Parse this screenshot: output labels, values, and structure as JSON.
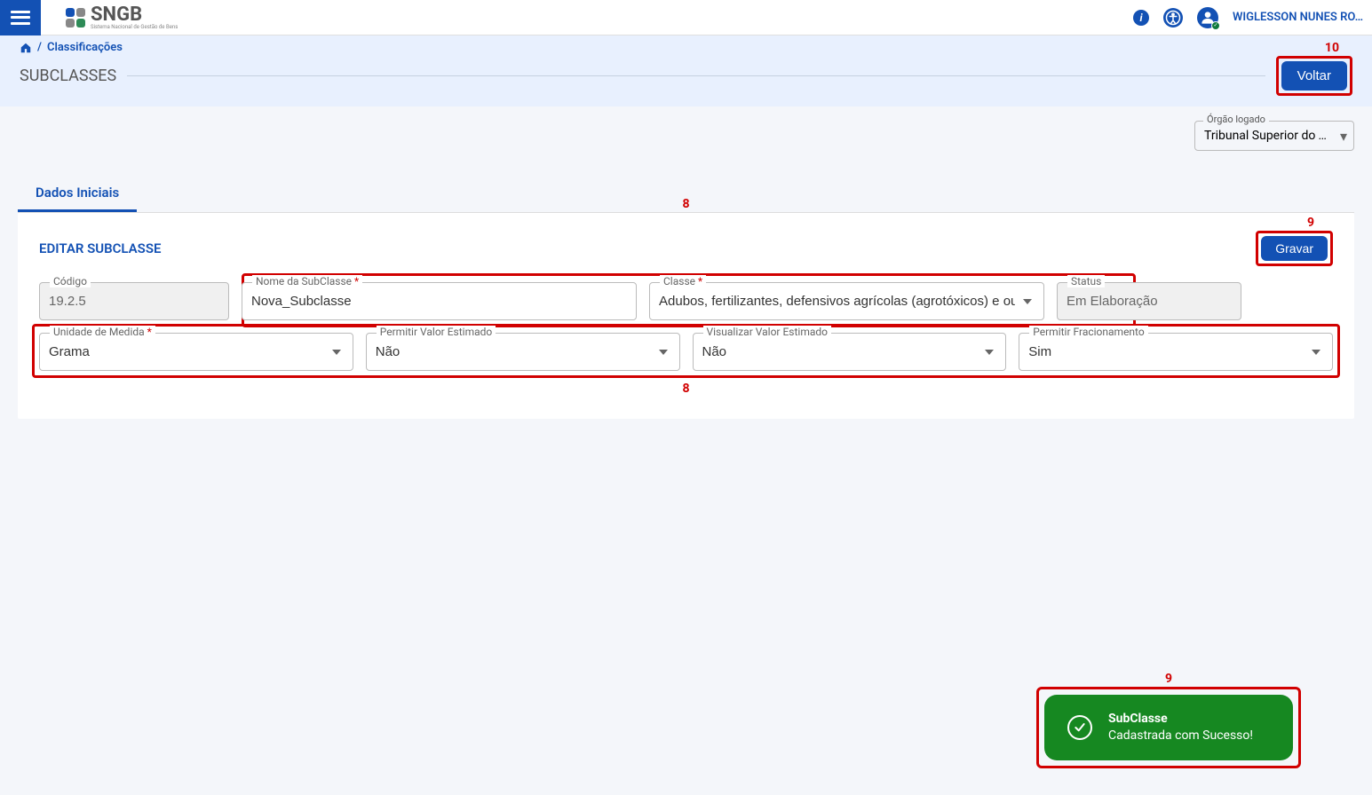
{
  "header": {
    "logo_main": "SNGB",
    "logo_sub": "Sistema Nacional de Gestão de Bens",
    "user_name": "WIGLESSON NUNES RO…"
  },
  "breadcrumb": {
    "separator": "/",
    "current": "Classificações"
  },
  "page": {
    "title": "SUBCLASSES",
    "voltar_label": "Voltar",
    "annot_10": "10"
  },
  "orgao": {
    "label": "Órgão logado",
    "value": "Tribunal Superior do Tra…"
  },
  "tab": {
    "label": "Dados Iniciais"
  },
  "form": {
    "title": "EDITAR SUBCLASSE",
    "gravar_label": "Gravar",
    "annot_9": "9",
    "annot_8": "8",
    "fields": {
      "codigo": {
        "label": "Código",
        "value": "19.2.5"
      },
      "nome": {
        "label": "Nome da SubClasse",
        "value": "Nova_Subclasse"
      },
      "classe": {
        "label": "Classe",
        "value": "Adubos, fertilizantes, defensivos agrícolas (agrotóxicos) e outros in"
      },
      "status": {
        "label": "Status",
        "value": "Em Elaboração"
      },
      "unidade": {
        "label": "Unidade de Medida",
        "value": "Grama"
      },
      "permitir_valor": {
        "label": "Permitir Valor Estimado",
        "value": "Não"
      },
      "visualizar_valor": {
        "label": "Visualizar Valor Estimado",
        "value": "Não"
      },
      "permitir_frac": {
        "label": "Permitir Fracionamento",
        "value": "Sim"
      }
    }
  },
  "toast": {
    "title": "SubClasse",
    "message": "Cadastrada com Sucesso!",
    "annot": "9"
  }
}
